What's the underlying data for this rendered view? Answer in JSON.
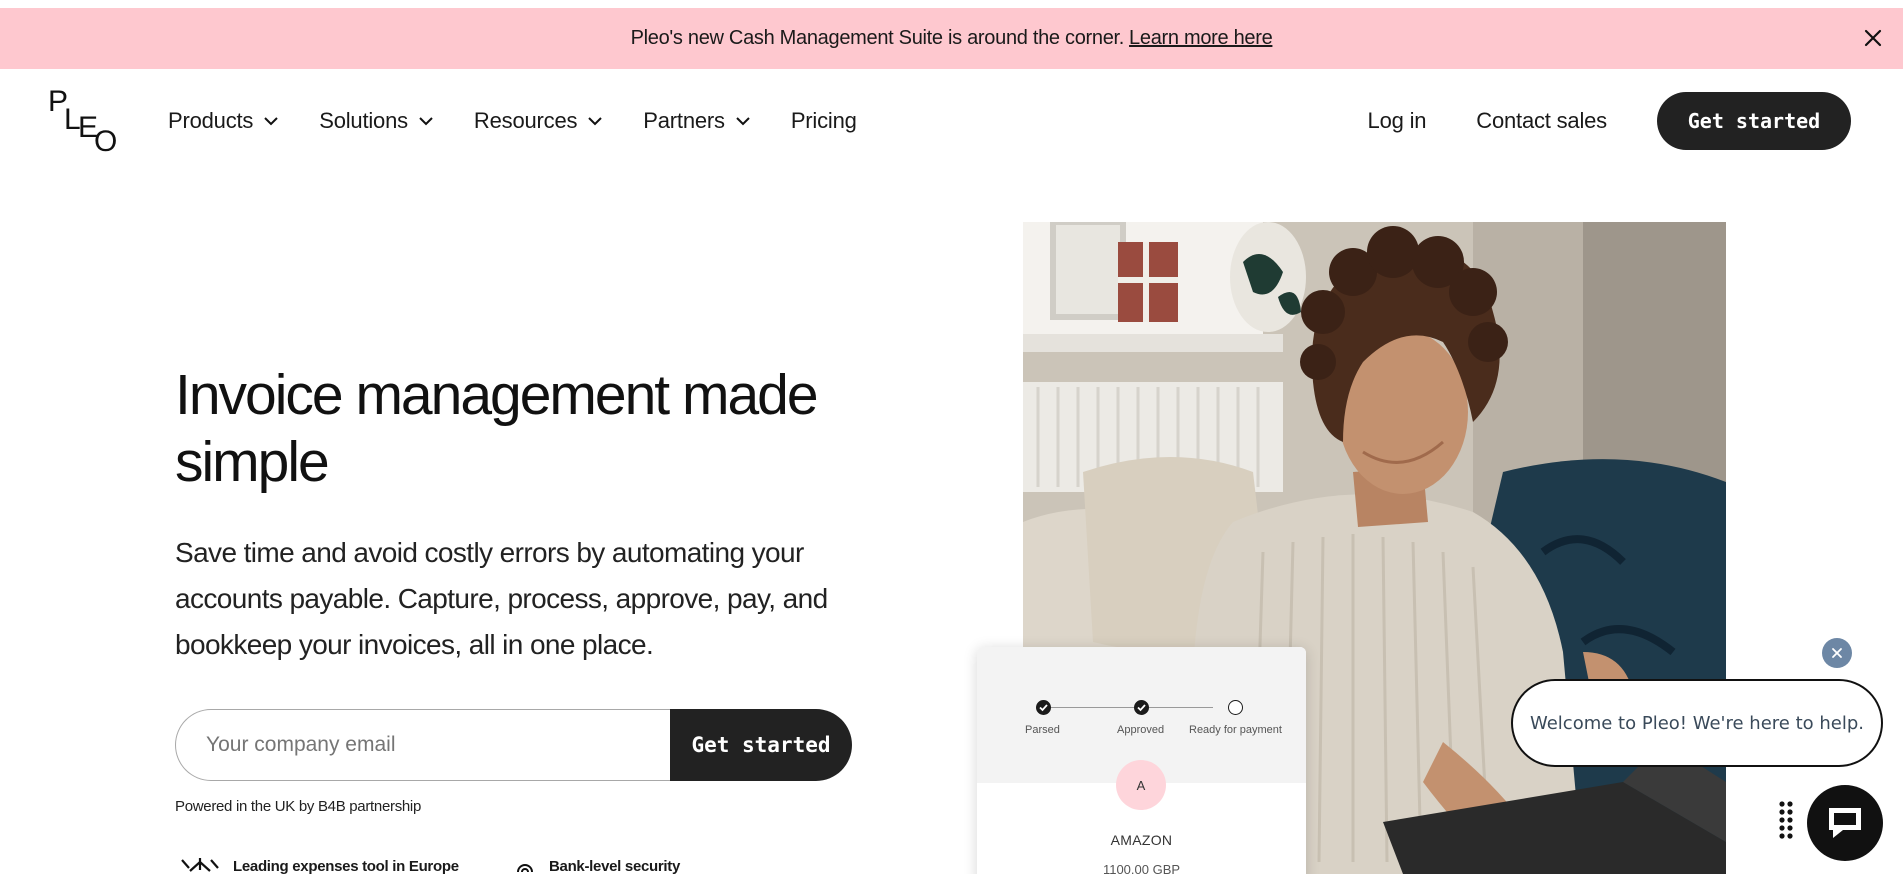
{
  "banner": {
    "text": "Pleo's new Cash Management Suite is around the corner.",
    "link": "Learn more here",
    "close_icon": "close-icon"
  },
  "nav": {
    "logo_letters": [
      "P",
      "L",
      "E",
      "O"
    ],
    "menu": [
      {
        "label": "Products",
        "dropdown": true
      },
      {
        "label": "Solutions",
        "dropdown": true
      },
      {
        "label": "Resources",
        "dropdown": true
      },
      {
        "label": "Partners",
        "dropdown": true
      },
      {
        "label": "Pricing",
        "dropdown": false
      }
    ],
    "login": "Log in",
    "contact": "Contact sales",
    "cta": "Get started"
  },
  "hero": {
    "title": "Invoice management made simple",
    "subtitle": "Save time and avoid costly errors by automating your accounts payable. Capture, process, approve, pay, and bookkeep your invoices, all in one place.",
    "email_placeholder": "Your company email",
    "cta": "Get started",
    "powered": "Powered in the UK by B4B partnership",
    "badges": [
      "Leading expenses tool in Europe",
      "Bank-level security"
    ]
  },
  "invoice_card": {
    "steps": [
      {
        "label": "Parsed",
        "done": true
      },
      {
        "label": "Approved",
        "done": true
      },
      {
        "label": "Ready for payment",
        "done": false
      }
    ],
    "vendor_initial": "A",
    "vendor_name": "AMAZON",
    "amount": "1100.00 GBP"
  },
  "chat": {
    "message": "Welcome to Pleo! We're here to help."
  },
  "colors": {
    "banner_bg": "#fec8cf",
    "button_dark": "#222222",
    "avatar_pink": "#fed5db",
    "chat_close": "#6d87a5"
  }
}
